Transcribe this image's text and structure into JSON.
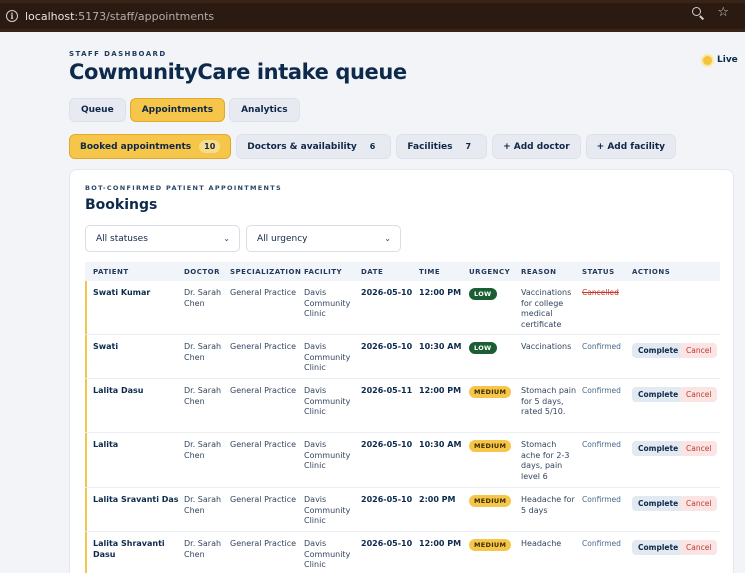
{
  "browser": {
    "url_host": "localhost",
    "url_path": ":5173/staff/appointments"
  },
  "header": {
    "kicker": "STAFF DASHBOARD",
    "title": "CowmunityCare intake queue",
    "live_label": "Live"
  },
  "tabs": [
    {
      "label": "Queue",
      "active": false
    },
    {
      "label": "Appointments",
      "active": true
    },
    {
      "label": "Analytics",
      "active": false
    }
  ],
  "subnav": [
    {
      "label": "Booked appointments",
      "count": "10",
      "active": true
    },
    {
      "label": "Doctors & availability",
      "count": "6",
      "active": false
    },
    {
      "label": "Facilities",
      "count": "7",
      "active": false
    },
    {
      "label": "+ Add doctor",
      "count": "",
      "active": false
    },
    {
      "label": "+ Add facility",
      "count": "",
      "active": false
    }
  ],
  "card": {
    "kicker": "BOT-CONFIRMED PATIENT APPOINTMENTS",
    "title": "Bookings",
    "filters": {
      "status": "All statuses",
      "urgency": "All urgency"
    }
  },
  "table": {
    "columns": [
      "PATIENT",
      "DOCTOR",
      "SPECIALIZATION",
      "FACILITY",
      "DATE",
      "TIME",
      "URGENCY",
      "REASON",
      "STATUS",
      "ACTIONS"
    ],
    "actions": {
      "complete": "Complete",
      "cancel": "Cancel"
    },
    "rows": [
      {
        "patient": "Swati Kumar",
        "doctor": "Dr. Sarah Chen",
        "specialization": "General Practice",
        "facility": "Davis Community Clinic",
        "date": "2026-05-10",
        "time": "12:00 PM",
        "urgency": "LOW",
        "reason": "Vaccinations for college medical certificate",
        "status": "Cancelled"
      },
      {
        "patient": "Swati",
        "doctor": "Dr. Sarah Chen",
        "specialization": "General Practice",
        "facility": "Davis Community Clinic",
        "date": "2026-05-10",
        "time": "10:30 AM",
        "urgency": "LOW",
        "reason": "Vaccinations",
        "status": "Confirmed"
      },
      {
        "patient": "Lalita Dasu",
        "doctor": "Dr. Sarah Chen",
        "specialization": "General Practice",
        "facility": "Davis Community Clinic",
        "date": "2026-05-11",
        "time": "12:00 PM",
        "urgency": "MEDIUM",
        "reason": "Stomach pain for 5 days, rated 5/10.",
        "status": "Confirmed"
      },
      {
        "patient": "Lalita",
        "doctor": "Dr. Sarah Chen",
        "specialization": "General Practice",
        "facility": "Davis Community Clinic",
        "date": "2026-05-10",
        "time": "10:30 AM",
        "urgency": "MEDIUM",
        "reason": "Stomach ache for 2-3 days, pain level 6",
        "status": "Confirmed"
      },
      {
        "patient": "Lalita Sravanti Das",
        "doctor": "Dr. Sarah Chen",
        "specialization": "General Practice",
        "facility": "Davis Community Clinic",
        "date": "2026-05-10",
        "time": "2:00 PM",
        "urgency": "MEDIUM",
        "reason": "Headache for 5 days",
        "status": "Confirmed"
      },
      {
        "patient": "Lalita Shravanti Dasu",
        "doctor": "Dr. Sarah Chen",
        "specialization": "General Practice",
        "facility": "Davis Community Clinic",
        "date": "2026-05-10",
        "time": "12:00 PM",
        "urgency": "MEDIUM",
        "reason": "Headache",
        "status": "Confirmed"
      }
    ]
  }
}
